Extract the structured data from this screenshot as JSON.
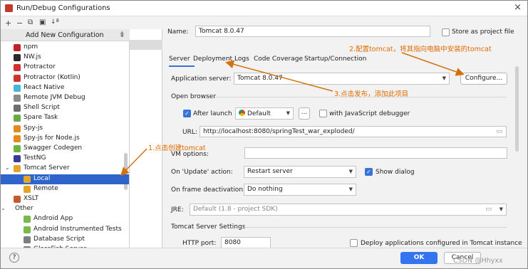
{
  "window": {
    "title": "Run/Debug Configurations",
    "close": "×"
  },
  "toolbar": {
    "add": "+",
    "remove": "−",
    "copy": "⧉",
    "folder": "▣",
    "sort": "↓ª"
  },
  "add_new": {
    "label": "Add New Configuration",
    "pin": "⇟"
  },
  "tree": [
    {
      "label": "npm",
      "color": "#c12127",
      "indent": 1
    },
    {
      "label": "NW.js",
      "color": "#2a2a2a",
      "indent": 1
    },
    {
      "label": "Protractor",
      "color": "#d0312d",
      "indent": 1
    },
    {
      "label": "Protractor (Kotlin)",
      "color": "#d0312d",
      "indent": 1
    },
    {
      "label": "React Native",
      "color": "#4bb3d6",
      "indent": 1
    },
    {
      "label": "Remote JVM Debug",
      "color": "#8a8a8a",
      "indent": 1
    },
    {
      "label": "Shell Script",
      "color": "#6e6e6e",
      "indent": 1
    },
    {
      "label": "Spare Task",
      "color": "#6aaa4c",
      "indent": 1
    },
    {
      "label": "Spy-js",
      "color": "#e08b1c",
      "indent": 1
    },
    {
      "label": "Spy-js for Node.js",
      "color": "#e08b1c",
      "indent": 1
    },
    {
      "label": "Swagger Codegen",
      "color": "#6cb33f",
      "indent": 1
    },
    {
      "label": "TestNG",
      "color": "#3a3a9a",
      "indent": 1
    },
    {
      "label": "Tomcat Server",
      "color": "#e4a42a",
      "indent": 1,
      "expanded": true
    },
    {
      "label": "Local",
      "color": "#e4a42a",
      "indent": 2,
      "selected": true
    },
    {
      "label": "Remote",
      "color": "#e4a42a",
      "indent": 2
    },
    {
      "label": "XSLT",
      "color": "#c75a2d",
      "indent": 1
    },
    {
      "label": "Other",
      "color": "",
      "indent": 0,
      "expanded": true
    },
    {
      "label": "Android App",
      "color": "#79b84b",
      "indent": 2
    },
    {
      "label": "Android Instrumented Tests",
      "color": "#79b84b",
      "indent": 2
    },
    {
      "label": "Database Script",
      "color": "#7e7e7e",
      "indent": 2
    },
    {
      "label": "GlassFish Server",
      "color": "#7e7e7e",
      "indent": 2
    }
  ],
  "form": {
    "name_label": "Name:",
    "name_value": "Tomcat 8.0.47",
    "store_project": "Store as project file",
    "tabs": [
      "Server",
      "Deployment",
      "Logs",
      "Code Coverage",
      "Startup/Connection"
    ],
    "app_server_label": "Application server:",
    "app_server_value": "Tomcat 8.0.47",
    "configure_btn": "Configure...",
    "open_browser": "Open browser",
    "after_launch": "After launch",
    "browser_value": "Default",
    "ellipsis_btn": "...",
    "js_debugger": "with JavaScript debugger",
    "url_label": "URL:",
    "url_value": "http://localhost:8080/springTest_war_exploded/",
    "vm_label": "VM options:",
    "on_update_label": "On 'Update' action:",
    "on_update_value": "Restart server",
    "show_dialog": "Show dialog",
    "on_frame_label": "On frame deactivation:",
    "on_frame_value": "Do nothing",
    "jre_label": "JRE:",
    "jre_value": "Default (1.8 - project SDK)",
    "tomcat_settings": "Tomcat Server Settings",
    "http_port_label": "HTTP port:",
    "http_port_value": "8080",
    "deploy_label": "Deploy applications configured in Tomcat instance"
  },
  "annotations": {
    "a1": "1.点击创建tomcat",
    "a2": "2.配置tomcat，将其指向电脑中安装的tomcat",
    "a3": "3.点击发布，添加此项目"
  },
  "bottom": {
    "help": "?",
    "ok": "OK",
    "cancel": "Cancel",
    "watermark": "CSDN @Hhyxx"
  }
}
